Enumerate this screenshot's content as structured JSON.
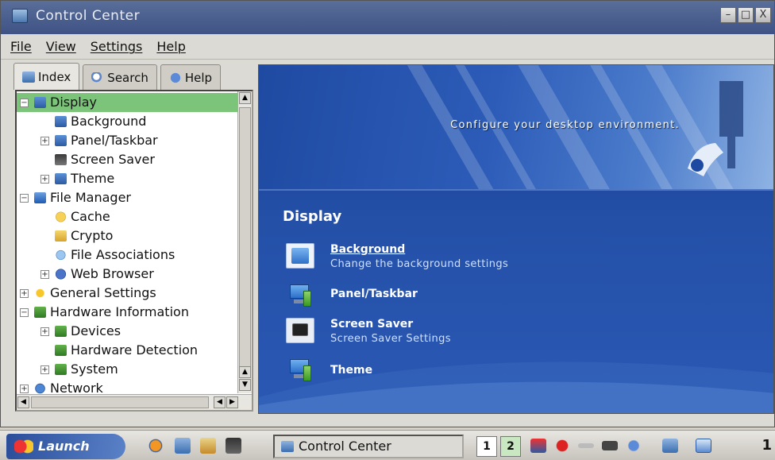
{
  "window": {
    "title": "Control Center",
    "buttons": {
      "minimize": "–",
      "maximize": "□",
      "close": "X"
    }
  },
  "menu": [
    "File",
    "View",
    "Settings",
    "Help"
  ],
  "tabs": [
    {
      "label": "Index",
      "icon": "index-icon",
      "active": true
    },
    {
      "label": "Search",
      "icon": "search-icon",
      "active": false
    },
    {
      "label": "Help",
      "icon": "help-icon",
      "active": false
    }
  ],
  "tree": [
    {
      "label": "Display",
      "level": 0,
      "expander": "minus",
      "icon": "display",
      "selected": true
    },
    {
      "label": "Background",
      "level": 1,
      "expander": "",
      "icon": "display"
    },
    {
      "label": "Panel/Taskbar",
      "level": 1,
      "expander": "plus",
      "icon": "display"
    },
    {
      "label": "Screen Saver",
      "level": 1,
      "expander": "",
      "icon": "screen"
    },
    {
      "label": "Theme",
      "level": 1,
      "expander": "plus",
      "icon": "display"
    },
    {
      "label": "File Manager",
      "level": 0,
      "expander": "minus",
      "icon": "folder"
    },
    {
      "label": "Cache",
      "level": 1,
      "expander": "",
      "icon": "cache"
    },
    {
      "label": "Crypto",
      "level": 1,
      "expander": "",
      "icon": "lock"
    },
    {
      "label": "File Associations",
      "level": 1,
      "expander": "",
      "icon": "assoc"
    },
    {
      "label": "Web Browser",
      "level": 1,
      "expander": "plus",
      "icon": "web"
    },
    {
      "label": "General Settings",
      "level": 0,
      "expander": "plus",
      "icon": "star"
    },
    {
      "label": "Hardware Information",
      "level": 0,
      "expander": "minus",
      "icon": "hw"
    },
    {
      "label": "Devices",
      "level": 1,
      "expander": "plus",
      "icon": "hw"
    },
    {
      "label": "Hardware Detection",
      "level": 1,
      "expander": "",
      "icon": "hw"
    },
    {
      "label": "System",
      "level": 1,
      "expander": "plus",
      "icon": "hw"
    },
    {
      "label": "Network",
      "level": 0,
      "expander": "plus",
      "icon": "net"
    }
  ],
  "banner": {
    "tagline": "Configure your desktop environment."
  },
  "section": {
    "title": "Display",
    "items": [
      {
        "title": "Background",
        "desc": "Change the background settings",
        "icon": "background-icon",
        "link": true
      },
      {
        "title": "Panel/Taskbar",
        "desc": "",
        "icon": "panel-taskbar-icon",
        "link": false
      },
      {
        "title": "Screen Saver",
        "desc": "Screen Saver Settings",
        "icon": "screen-saver-icon",
        "link": false
      },
      {
        "title": "Theme",
        "desc": "",
        "icon": "theme-icon",
        "link": false
      }
    ]
  },
  "taskbar": {
    "launch": "Launch",
    "task": "Control Center",
    "desktops": [
      "1",
      "2"
    ],
    "active_desktop": "2",
    "clock": "1"
  }
}
